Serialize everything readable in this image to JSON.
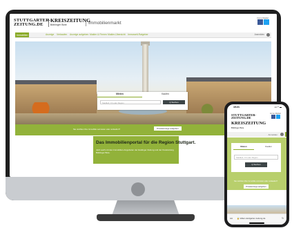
{
  "desktop": {
    "logo_line1": "STUTTGARTER-",
    "logo_line2": "ZEITUNG.DE",
    "logo2_line1": "KREISZEITUNG",
    "logo2_tag": "Böblinger Bote",
    "section_title": "Immobilienmarkt",
    "top_right": "Immo Digital",
    "nav_items": [
      "Immobilien",
      "Anzeige",
      "Verkaufen",
      "Anzeige aufgeben",
      "Makler & Firmen",
      "Makler-Übersicht",
      "Immowelt-Ratgeber"
    ],
    "login_label": "Anmelden",
    "search": {
      "tab_rent": "Mieten",
      "tab_buy": "Kaufen",
      "placeholder": "Stadtteil, Ort oder Region",
      "button": "Q Suchen"
    },
    "strip_text": "Sie möchten Ihre Immobilie vermieten oder verkaufen?",
    "strip_button": "Privatanzeige aufgeben",
    "promo_heading": "Das Immobilienportal für die Region Stuttgart.",
    "promo_text": "Jetzt auch mit den Immobilien-Angeboten der Esslinger Zeitung und der Kreiszeitung Böblinger Bote."
  },
  "phone": {
    "time": "10:21",
    "signal": "▪▪▪ ◠ ▬",
    "logo_line1": "STUTTGARTER-",
    "logo_line2": "ZEITUNG.DE",
    "logo2_line1": "KREISZEITUNG",
    "logo2_tag": "Böblinger Bote",
    "top_right": "Immo Digital",
    "login_label": "Anmelden",
    "tab_rent": "Mieten",
    "tab_buy": "Kaufen",
    "placeholder": "Stadtteil, Ort oder Region",
    "button": "Q Suchen",
    "strip_text": "Sie möchten Ihre Immobilie vermieten oder verkaufen?",
    "strip_button": "Privatanzeige aufgeben",
    "url_aa": "AA",
    "url": "🔒 kitlien.stuttgarter-zeitung.de",
    "reload": "↻"
  },
  "colors": {
    "accent_green": "#92b23a",
    "dark_button": "#3d4547",
    "bezel": "#1f1f1f"
  }
}
